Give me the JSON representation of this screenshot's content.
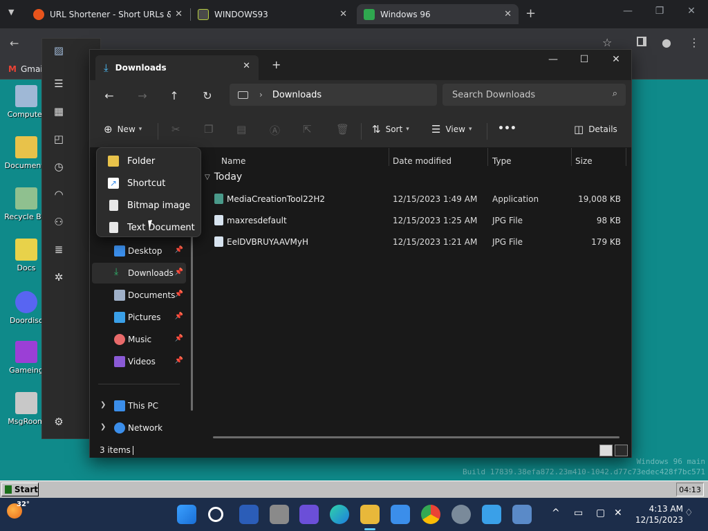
{
  "browser": {
    "tabs": [
      {
        "title": "URL Shortener - Short URLs & C",
        "favicon_color": "#e8541c"
      },
      {
        "title": "WINDOWS93",
        "favicon_color": "#4a4a4a"
      },
      {
        "title": "Windows 96",
        "favicon_color": "#2fa84f",
        "active": true
      }
    ],
    "new_tab_label": "+",
    "bookmark": "Gmai"
  },
  "desktop": {
    "icons": [
      {
        "label": "Computer",
        "color": "#9fb8d6"
      },
      {
        "label": "Documents",
        "color": "#e8c24a"
      },
      {
        "label": "Recycle Bin",
        "color": "#8fc08f"
      },
      {
        "label": "Docs",
        "color": "#e8d24a"
      },
      {
        "label": "Doordisc",
        "color": "#5865f2"
      },
      {
        "label": "Gameing",
        "color": "#9b3fd6"
      },
      {
        "label": "MsgRoom",
        "color": "#c8c8c8"
      }
    ],
    "watermark_line1": "Windows 96 main",
    "watermark_line2": "Build 17839.38efa872.23m410-1042.d77c73edec428f7bc571"
  },
  "explorer": {
    "tab_title": "Downloads",
    "address_path": "Downloads",
    "search_placeholder": "Search Downloads",
    "toolbar": {
      "new_label": "New",
      "sort_label": "Sort",
      "view_label": "View",
      "more_label": "•••",
      "details_label": "Details"
    },
    "new_menu": [
      {
        "label": "Folder",
        "icon": "folder-icon",
        "color": "#e8c24a"
      },
      {
        "label": "Shortcut",
        "icon": "shortcut-icon",
        "color": "#3b8eea"
      },
      {
        "label": "Bitmap image",
        "icon": "bitmap-icon",
        "color": "#e8e8e8"
      },
      {
        "label": "Text Document",
        "icon": "text-document-icon",
        "color": "#e8e8e8"
      }
    ],
    "nav_items": [
      {
        "label": "Desktop",
        "color": "#3b8eea",
        "pinned": true
      },
      {
        "label": "Downloads",
        "color": "#2fb26b",
        "pinned": true,
        "selected": true
      },
      {
        "label": "Documents",
        "color": "#9fb0c8",
        "pinned": true
      },
      {
        "label": "Pictures",
        "color": "#3aa0e8",
        "pinned": true
      },
      {
        "label": "Music",
        "color": "#e86a6a",
        "pinned": true
      },
      {
        "label": "Videos",
        "color": "#8a5ad6",
        "pinned": true
      },
      {
        "label": "This PC",
        "color": "#3b8eea",
        "pinned": false
      },
      {
        "label": "Network",
        "color": "#3b8eea",
        "pinned": false
      }
    ],
    "columns": [
      "Name",
      "Date modified",
      "Type",
      "Size"
    ],
    "group_label": "Today",
    "files": [
      {
        "name": "MediaCreationTool22H2",
        "date": "12/15/2023 1:49 AM",
        "type": "Application",
        "size": "19,008 KB",
        "icon_color": "#4a9a8a"
      },
      {
        "name": "maxresdefault",
        "date": "12/15/2023 1:25 AM",
        "type": "JPG File",
        "size": "98 KB",
        "icon_color": "#d8e4f0"
      },
      {
        "name": "EelDVBRUYAAVMyH",
        "date": "12/15/2023 1:21 AM",
        "type": "JPG File",
        "size": "179 KB",
        "icon_color": "#d8e4f0"
      }
    ],
    "status": "3 items"
  },
  "win96_taskbar": {
    "start_label": "Start",
    "clock": "04:13"
  },
  "win11_taskbar": {
    "temperature": "32°",
    "time": "4:13 AM",
    "date": "12/15/2023"
  }
}
